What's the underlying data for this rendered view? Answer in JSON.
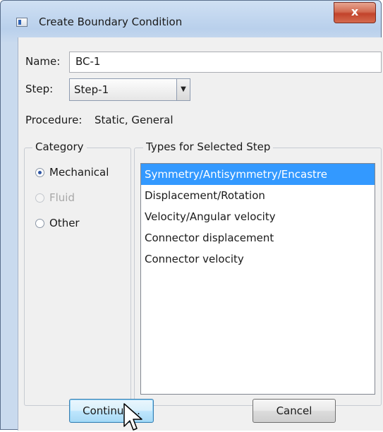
{
  "window": {
    "title": "Create Boundary Condition",
    "close_glyph": "x"
  },
  "form": {
    "name_label": "Name:",
    "name_value": "BC-1",
    "step_label": "Step:",
    "step_value": "Step-1",
    "procedure_label": "Procedure:",
    "procedure_value": "Static, General"
  },
  "category": {
    "title": "Category",
    "options": [
      {
        "label": "Mechanical",
        "checked": true,
        "enabled": true
      },
      {
        "label": "Fluid",
        "checked": false,
        "enabled": false
      },
      {
        "label": "Other",
        "checked": false,
        "enabled": true
      }
    ]
  },
  "types": {
    "title": "Types for Selected Step",
    "items": [
      "Symmetry/Antisymmetry/Encastre",
      "Displacement/Rotation",
      "Velocity/Angular velocity",
      "Connector displacement",
      "Connector velocity"
    ],
    "selected_index": 0
  },
  "buttons": {
    "continue_label": "Continue...",
    "cancel_label": "Cancel"
  },
  "icons": {
    "window": "dialog-window-icon",
    "close": "close-icon",
    "dropdown": "chevron-down-icon",
    "cursor": "mouse-pointer-icon"
  },
  "colors": {
    "selection": "#3399ff",
    "close_button": "#c2432b",
    "title_bar": "#b9d0ec"
  }
}
